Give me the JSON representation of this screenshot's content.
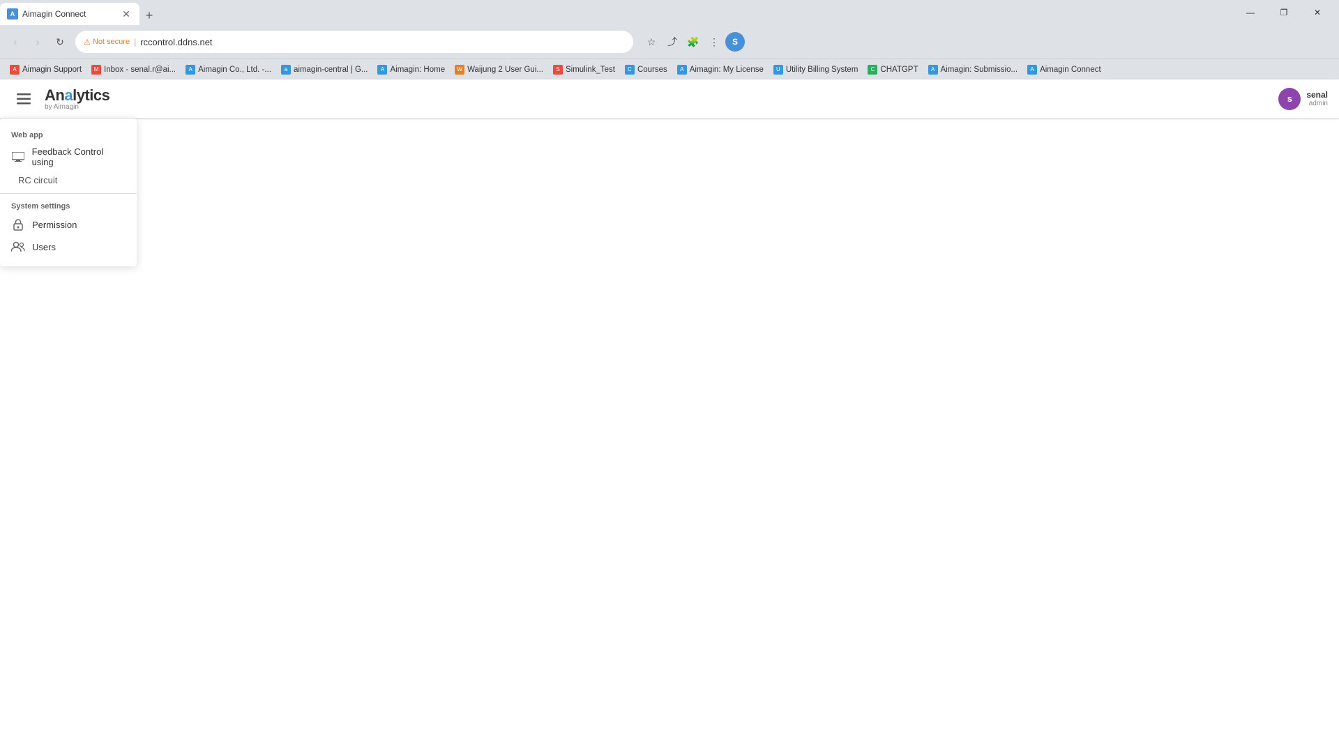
{
  "browser": {
    "tab": {
      "title": "Aimagin Connect",
      "favicon_letter": "A"
    },
    "new_tab_label": "+",
    "window_controls": {
      "minimize": "—",
      "maximize": "❐",
      "close": "✕"
    },
    "nav": {
      "back": "‹",
      "forward": "›",
      "refresh": "↻"
    },
    "address": {
      "security_label": "Not secure",
      "url": "rccontrol.ddns.net"
    },
    "bookmarks": [
      {
        "label": "Aimagin Support",
        "color": "#e74c3c"
      },
      {
        "label": "Inbox - senal.r@ai...",
        "color": "#e74c3c"
      },
      {
        "label": "Aimagin Co., Ltd. -...",
        "color": "#3498db"
      },
      {
        "label": "aimagin-central | G...",
        "color": "#3498db"
      },
      {
        "label": "Aimagin: Home",
        "color": "#3498db"
      },
      {
        "label": "Waijung 2 User Gui...",
        "color": "#e67e22"
      },
      {
        "label": "Simulink_Test",
        "color": "#e74c3c"
      },
      {
        "label": "Courses",
        "color": "#3498db"
      },
      {
        "label": "Aimagin: My License",
        "color": "#3498db"
      },
      {
        "label": "Utility Billing System",
        "color": "#3498db"
      },
      {
        "label": "CHATGPT",
        "color": "#27ae60"
      },
      {
        "label": "Aimagin: Submissio...",
        "color": "#3498db"
      },
      {
        "label": "Aimagin Connect",
        "color": "#3498db"
      }
    ]
  },
  "app": {
    "title": "Analytics",
    "subtitle": "by Aimagin",
    "user": {
      "name": "senal",
      "role": "admin",
      "avatar_letter": "s"
    },
    "menu": {
      "web_app_section": "Web app",
      "items_web": [
        {
          "label": "Feedback Control using",
          "sub": "RC circuit",
          "icon": "⬛"
        },
        {
          "label": "RC circuit"
        }
      ],
      "system_settings_section": "System settings",
      "items_system": [
        {
          "label": "Permission",
          "icon": "🔒"
        },
        {
          "label": "Users",
          "icon": "👥"
        }
      ]
    }
  }
}
